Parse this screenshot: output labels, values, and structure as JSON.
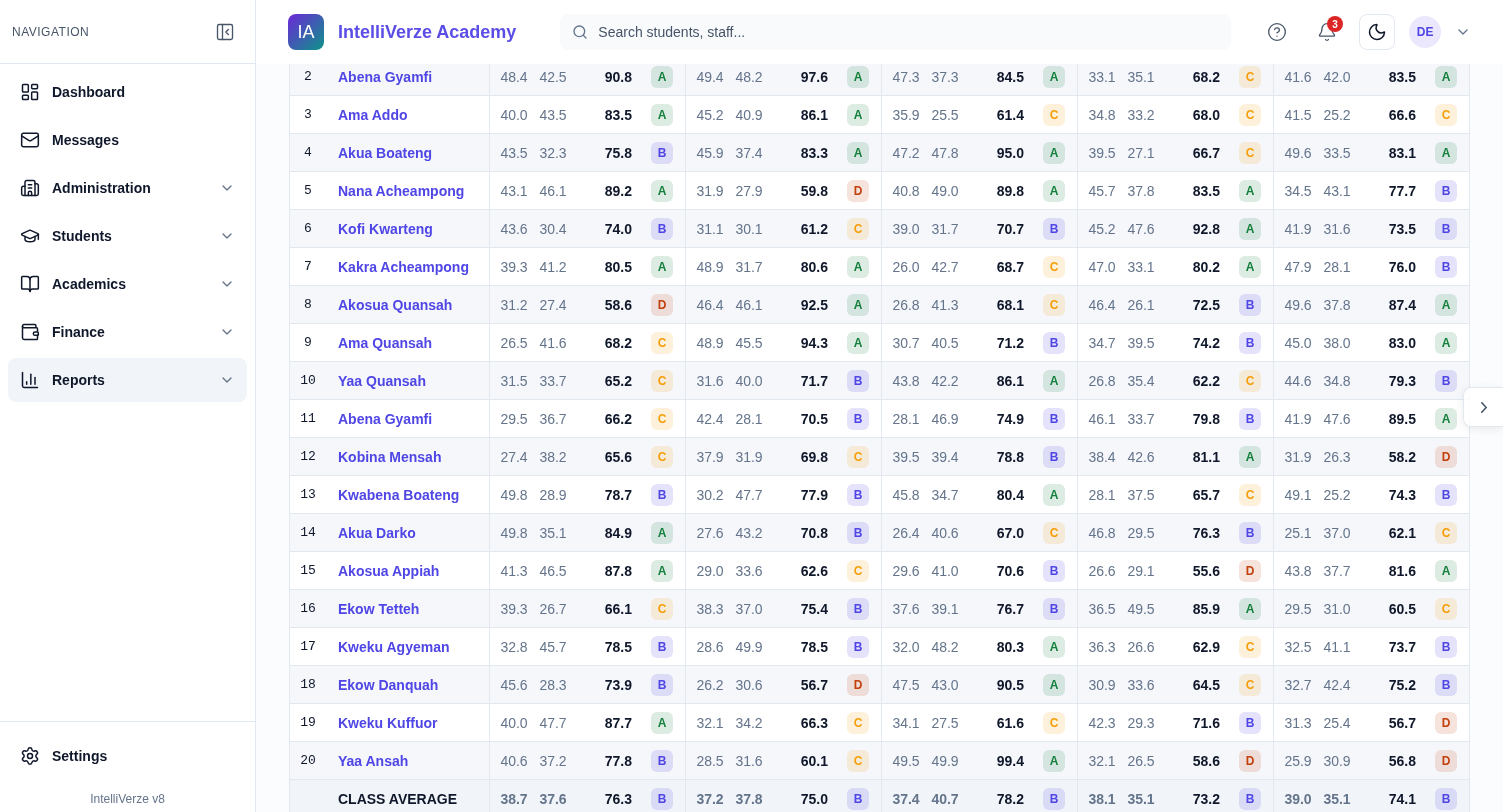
{
  "sidebar": {
    "heading": "NAVIGATION",
    "items": [
      {
        "label": "Dashboard",
        "expandable": false,
        "selected": false
      },
      {
        "label": "Messages",
        "expandable": false,
        "selected": false
      },
      {
        "label": "Administration",
        "expandable": true,
        "selected": false
      },
      {
        "label": "Students",
        "expandable": true,
        "selected": false
      },
      {
        "label": "Academics",
        "expandable": true,
        "selected": false
      },
      {
        "label": "Finance",
        "expandable": true,
        "selected": false
      },
      {
        "label": "Reports",
        "expandable": true,
        "selected": true
      }
    ],
    "footer": {
      "label": "Settings",
      "version": "IntelliVerze v8"
    }
  },
  "header": {
    "logo": "IA",
    "brand": "IntelliVerze Academy",
    "search": {
      "placeholder": "Search students, staff..."
    },
    "notifications": "3",
    "avatar": "DE"
  },
  "table": {
    "rows": [
      {
        "no": "2",
        "name": "Abena Gyamfi",
        "subjects": [
          {
            "a": "48.4",
            "b": "42.5",
            "total": "90.8",
            "grade": "A",
            "color": "#15803d"
          },
          {
            "a": "49.4",
            "b": "48.2",
            "total": "97.6",
            "grade": "A",
            "color": "#15803d"
          },
          {
            "a": "47.3",
            "b": "37.3",
            "total": "84.5",
            "grade": "A",
            "color": "#15803d"
          },
          {
            "a": "33.1",
            "b": "35.1",
            "total": "68.2",
            "grade": "C",
            "color": "#f59e0b"
          },
          {
            "a": "41.6",
            "b": "42.0",
            "total": "83.5",
            "grade": "A",
            "color": "#15803d"
          }
        ]
      },
      {
        "no": "3",
        "name": "Ama Addo",
        "subjects": [
          {
            "a": "40.0",
            "b": "43.5",
            "total": "83.5",
            "grade": "A",
            "color": "#15803d"
          },
          {
            "a": "45.2",
            "b": "40.9",
            "total": "86.1",
            "grade": "A",
            "color": "#15803d"
          },
          {
            "a": "35.9",
            "b": "25.5",
            "total": "61.4",
            "grade": "C",
            "color": "#f59e0b"
          },
          {
            "a": "34.8",
            "b": "33.2",
            "total": "68.0",
            "grade": "C",
            "color": "#f59e0b"
          },
          {
            "a": "41.5",
            "b": "25.2",
            "total": "66.6",
            "grade": "C",
            "color": "#f59e0b"
          }
        ]
      },
      {
        "no": "4",
        "name": "Akua Boateng",
        "subjects": [
          {
            "a": "43.5",
            "b": "32.3",
            "total": "75.8",
            "grade": "B",
            "color": "#4f46e5"
          },
          {
            "a": "45.9",
            "b": "37.4",
            "total": "83.3",
            "grade": "A",
            "color": "#15803d"
          },
          {
            "a": "47.2",
            "b": "47.8",
            "total": "95.0",
            "grade": "A",
            "color": "#15803d"
          },
          {
            "a": "39.5",
            "b": "27.1",
            "total": "66.7",
            "grade": "C",
            "color": "#f59e0b"
          },
          {
            "a": "49.6",
            "b": "33.5",
            "total": "83.1",
            "grade": "A",
            "color": "#15803d"
          }
        ]
      },
      {
        "no": "5",
        "name": "Nana Acheampong",
        "subjects": [
          {
            "a": "43.1",
            "b": "46.1",
            "total": "89.2",
            "grade": "A",
            "color": "#15803d"
          },
          {
            "a": "31.9",
            "b": "27.9",
            "total": "59.8",
            "grade": "D",
            "color": "#c2410c"
          },
          {
            "a": "40.8",
            "b": "49.0",
            "total": "89.8",
            "grade": "A",
            "color": "#15803d"
          },
          {
            "a": "45.7",
            "b": "37.8",
            "total": "83.5",
            "grade": "A",
            "color": "#15803d"
          },
          {
            "a": "34.5",
            "b": "43.1",
            "total": "77.7",
            "grade": "B",
            "color": "#4f46e5"
          }
        ]
      },
      {
        "no": "6",
        "name": "Kofi Kwarteng",
        "subjects": [
          {
            "a": "43.6",
            "b": "30.4",
            "total": "74.0",
            "grade": "B",
            "color": "#4f46e5"
          },
          {
            "a": "31.1",
            "b": "30.1",
            "total": "61.2",
            "grade": "C",
            "color": "#f59e0b"
          },
          {
            "a": "39.0",
            "b": "31.7",
            "total": "70.7",
            "grade": "B",
            "color": "#4f46e5"
          },
          {
            "a": "45.2",
            "b": "47.6",
            "total": "92.8",
            "grade": "A",
            "color": "#15803d"
          },
          {
            "a": "41.9",
            "b": "31.6",
            "total": "73.5",
            "grade": "B",
            "color": "#4f46e5"
          }
        ]
      },
      {
        "no": "7",
        "name": "Kakra Acheampong",
        "subjects": [
          {
            "a": "39.3",
            "b": "41.2",
            "total": "80.5",
            "grade": "A",
            "color": "#15803d"
          },
          {
            "a": "48.9",
            "b": "31.7",
            "total": "80.6",
            "grade": "A",
            "color": "#15803d"
          },
          {
            "a": "26.0",
            "b": "42.7",
            "total": "68.7",
            "grade": "C",
            "color": "#f59e0b"
          },
          {
            "a": "47.0",
            "b": "33.1",
            "total": "80.2",
            "grade": "A",
            "color": "#15803d"
          },
          {
            "a": "47.9",
            "b": "28.1",
            "total": "76.0",
            "grade": "B",
            "color": "#4f46e5"
          }
        ]
      },
      {
        "no": "8",
        "name": "Akosua Quansah",
        "subjects": [
          {
            "a": "31.2",
            "b": "27.4",
            "total": "58.6",
            "grade": "D",
            "color": "#c2410c"
          },
          {
            "a": "46.4",
            "b": "46.1",
            "total": "92.5",
            "grade": "A",
            "color": "#15803d"
          },
          {
            "a": "26.8",
            "b": "41.3",
            "total": "68.1",
            "grade": "C",
            "color": "#f59e0b"
          },
          {
            "a": "46.4",
            "b": "26.1",
            "total": "72.5",
            "grade": "B",
            "color": "#4f46e5"
          },
          {
            "a": "49.6",
            "b": "37.8",
            "total": "87.4",
            "grade": "A",
            "color": "#15803d"
          }
        ]
      },
      {
        "no": "9",
        "name": "Ama Quansah",
        "subjects": [
          {
            "a": "26.5",
            "b": "41.6",
            "total": "68.2",
            "grade": "C",
            "color": "#f59e0b"
          },
          {
            "a": "48.9",
            "b": "45.5",
            "total": "94.3",
            "grade": "A",
            "color": "#15803d"
          },
          {
            "a": "30.7",
            "b": "40.5",
            "total": "71.2",
            "grade": "B",
            "color": "#4f46e5"
          },
          {
            "a": "34.7",
            "b": "39.5",
            "total": "74.2",
            "grade": "B",
            "color": "#4f46e5"
          },
          {
            "a": "45.0",
            "b": "38.0",
            "total": "83.0",
            "grade": "A",
            "color": "#15803d"
          }
        ]
      },
      {
        "no": "10",
        "name": "Yaa Quansah",
        "subjects": [
          {
            "a": "31.5",
            "b": "33.7",
            "total": "65.2",
            "grade": "C",
            "color": "#f59e0b"
          },
          {
            "a": "31.6",
            "b": "40.0",
            "total": "71.7",
            "grade": "B",
            "color": "#4f46e5"
          },
          {
            "a": "43.8",
            "b": "42.2",
            "total": "86.1",
            "grade": "A",
            "color": "#15803d"
          },
          {
            "a": "26.8",
            "b": "35.4",
            "total": "62.2",
            "grade": "C",
            "color": "#f59e0b"
          },
          {
            "a": "44.6",
            "b": "34.8",
            "total": "79.3",
            "grade": "B",
            "color": "#4f46e5"
          }
        ]
      },
      {
        "no": "11",
        "name": "Abena Gyamfi",
        "subjects": [
          {
            "a": "29.5",
            "b": "36.7",
            "total": "66.2",
            "grade": "C",
            "color": "#f59e0b"
          },
          {
            "a": "42.4",
            "b": "28.1",
            "total": "70.5",
            "grade": "B",
            "color": "#4f46e5"
          },
          {
            "a": "28.1",
            "b": "46.9",
            "total": "74.9",
            "grade": "B",
            "color": "#4f46e5"
          },
          {
            "a": "46.1",
            "b": "33.7",
            "total": "79.8",
            "grade": "B",
            "color": "#4f46e5"
          },
          {
            "a": "41.9",
            "b": "47.6",
            "total": "89.5",
            "grade": "A",
            "color": "#15803d"
          }
        ]
      },
      {
        "no": "12",
        "name": "Kobina Mensah",
        "subjects": [
          {
            "a": "27.4",
            "b": "38.2",
            "total": "65.6",
            "grade": "C",
            "color": "#f59e0b"
          },
          {
            "a": "37.9",
            "b": "31.9",
            "total": "69.8",
            "grade": "C",
            "color": "#f59e0b"
          },
          {
            "a": "39.5",
            "b": "39.4",
            "total": "78.8",
            "grade": "B",
            "color": "#4f46e5"
          },
          {
            "a": "38.4",
            "b": "42.6",
            "total": "81.1",
            "grade": "A",
            "color": "#15803d"
          },
          {
            "a": "31.9",
            "b": "26.3",
            "total": "58.2",
            "grade": "D",
            "color": "#c2410c"
          }
        ]
      },
      {
        "no": "13",
        "name": "Kwabena Boateng",
        "subjects": [
          {
            "a": "49.8",
            "b": "28.9",
            "total": "78.7",
            "grade": "B",
            "color": "#4f46e5"
          },
          {
            "a": "30.2",
            "b": "47.7",
            "total": "77.9",
            "grade": "B",
            "color": "#4f46e5"
          },
          {
            "a": "45.8",
            "b": "34.7",
            "total": "80.4",
            "grade": "A",
            "color": "#15803d"
          },
          {
            "a": "28.1",
            "b": "37.5",
            "total": "65.7",
            "grade": "C",
            "color": "#f59e0b"
          },
          {
            "a": "49.1",
            "b": "25.2",
            "total": "74.3",
            "grade": "B",
            "color": "#4f46e5"
          }
        ]
      },
      {
        "no": "14",
        "name": "Akua Darko",
        "subjects": [
          {
            "a": "49.8",
            "b": "35.1",
            "total": "84.9",
            "grade": "A",
            "color": "#15803d"
          },
          {
            "a": "27.6",
            "b": "43.2",
            "total": "70.8",
            "grade": "B",
            "color": "#4f46e5"
          },
          {
            "a": "26.4",
            "b": "40.6",
            "total": "67.0",
            "grade": "C",
            "color": "#f59e0b"
          },
          {
            "a": "46.8",
            "b": "29.5",
            "total": "76.3",
            "grade": "B",
            "color": "#4f46e5"
          },
          {
            "a": "25.1",
            "b": "37.0",
            "total": "62.1",
            "grade": "C",
            "color": "#f59e0b"
          }
        ]
      },
      {
        "no": "15",
        "name": "Akosua Appiah",
        "subjects": [
          {
            "a": "41.3",
            "b": "46.5",
            "total": "87.8",
            "grade": "A",
            "color": "#15803d"
          },
          {
            "a": "29.0",
            "b": "33.6",
            "total": "62.6",
            "grade": "C",
            "color": "#f59e0b"
          },
          {
            "a": "29.6",
            "b": "41.0",
            "total": "70.6",
            "grade": "B",
            "color": "#4f46e5"
          },
          {
            "a": "26.6",
            "b": "29.1",
            "total": "55.6",
            "grade": "D",
            "color": "#c2410c"
          },
          {
            "a": "43.8",
            "b": "37.7",
            "total": "81.6",
            "grade": "A",
            "color": "#15803d"
          }
        ]
      },
      {
        "no": "16",
        "name": "Ekow Tetteh",
        "subjects": [
          {
            "a": "39.3",
            "b": "26.7",
            "total": "66.1",
            "grade": "C",
            "color": "#f59e0b"
          },
          {
            "a": "38.3",
            "b": "37.0",
            "total": "75.4",
            "grade": "B",
            "color": "#4f46e5"
          },
          {
            "a": "37.6",
            "b": "39.1",
            "total": "76.7",
            "grade": "B",
            "color": "#4f46e5"
          },
          {
            "a": "36.5",
            "b": "49.5",
            "total": "85.9",
            "grade": "A",
            "color": "#15803d"
          },
          {
            "a": "29.5",
            "b": "31.0",
            "total": "60.5",
            "grade": "C",
            "color": "#f59e0b"
          }
        ]
      },
      {
        "no": "17",
        "name": "Kweku Agyeman",
        "subjects": [
          {
            "a": "32.8",
            "b": "45.7",
            "total": "78.5",
            "grade": "B",
            "color": "#4f46e5"
          },
          {
            "a": "28.6",
            "b": "49.9",
            "total": "78.5",
            "grade": "B",
            "color": "#4f46e5"
          },
          {
            "a": "32.0",
            "b": "48.2",
            "total": "80.3",
            "grade": "A",
            "color": "#15803d"
          },
          {
            "a": "36.3",
            "b": "26.6",
            "total": "62.9",
            "grade": "C",
            "color": "#f59e0b"
          },
          {
            "a": "32.5",
            "b": "41.1",
            "total": "73.7",
            "grade": "B",
            "color": "#4f46e5"
          }
        ]
      },
      {
        "no": "18",
        "name": "Ekow Danquah",
        "subjects": [
          {
            "a": "45.6",
            "b": "28.3",
            "total": "73.9",
            "grade": "B",
            "color": "#4f46e5"
          },
          {
            "a": "26.2",
            "b": "30.6",
            "total": "56.7",
            "grade": "D",
            "color": "#c2410c"
          },
          {
            "a": "47.5",
            "b": "43.0",
            "total": "90.5",
            "grade": "A",
            "color": "#15803d"
          },
          {
            "a": "30.9",
            "b": "33.6",
            "total": "64.5",
            "grade": "C",
            "color": "#f59e0b"
          },
          {
            "a": "32.7",
            "b": "42.4",
            "total": "75.2",
            "grade": "B",
            "color": "#4f46e5"
          }
        ]
      },
      {
        "no": "19",
        "name": "Kweku Kuffuor",
        "subjects": [
          {
            "a": "40.0",
            "b": "47.7",
            "total": "87.7",
            "grade": "A",
            "color": "#15803d"
          },
          {
            "a": "32.1",
            "b": "34.2",
            "total": "66.3",
            "grade": "C",
            "color": "#f59e0b"
          },
          {
            "a": "34.1",
            "b": "27.5",
            "total": "61.6",
            "grade": "C",
            "color": "#f59e0b"
          },
          {
            "a": "42.3",
            "b": "29.3",
            "total": "71.6",
            "grade": "B",
            "color": "#4f46e5"
          },
          {
            "a": "31.3",
            "b": "25.4",
            "total": "56.7",
            "grade": "D",
            "color": "#c2410c"
          }
        ]
      },
      {
        "no": "20",
        "name": "Yaa Ansah",
        "subjects": [
          {
            "a": "40.6",
            "b": "37.2",
            "total": "77.8",
            "grade": "B",
            "color": "#4f46e5"
          },
          {
            "a": "28.5",
            "b": "31.6",
            "total": "60.1",
            "grade": "C",
            "color": "#f59e0b"
          },
          {
            "a": "49.5",
            "b": "49.9",
            "total": "99.4",
            "grade": "A",
            "color": "#15803d"
          },
          {
            "a": "32.1",
            "b": "26.5",
            "total": "58.6",
            "grade": "D",
            "color": "#c2410c"
          },
          {
            "a": "25.9",
            "b": "30.9",
            "total": "56.8",
            "grade": "D",
            "color": "#c2410c"
          }
        ]
      }
    ],
    "average": {
      "label": "CLASS AVERAGE",
      "subjects": [
        {
          "a": "38.7",
          "b": "37.6",
          "total": "76.3",
          "grade": "B",
          "color": "#4f46e5"
        },
        {
          "a": "37.2",
          "b": "37.8",
          "total": "75.0",
          "grade": "B",
          "color": "#4f46e5"
        },
        {
          "a": "37.4",
          "b": "40.7",
          "total": "78.2",
          "grade": "B",
          "color": "#4f46e5"
        },
        {
          "a": "38.1",
          "b": "35.1",
          "total": "73.2",
          "grade": "B",
          "color": "#4f46e5"
        },
        {
          "a": "39.0",
          "b": "35.1",
          "total": "74.1",
          "grade": "B",
          "color": "#4f46e5"
        }
      ]
    }
  }
}
